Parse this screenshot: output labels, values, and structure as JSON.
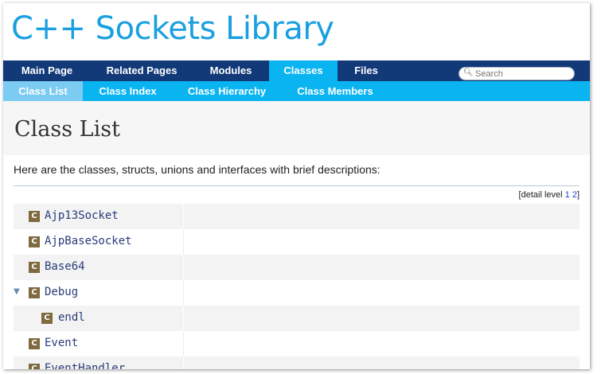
{
  "header": {
    "title": "C++ Sockets Library"
  },
  "nav_main": {
    "tabs": [
      {
        "label": "Main Page"
      },
      {
        "label": "Related Pages"
      },
      {
        "label": "Modules"
      },
      {
        "label": "Classes"
      },
      {
        "label": "Files"
      }
    ],
    "active": "Classes"
  },
  "search": {
    "placeholder": "Search",
    "icon": "search-icon"
  },
  "nav_sub": {
    "tabs": [
      {
        "label": "Class List"
      },
      {
        "label": "Class Index"
      },
      {
        "label": "Class Hierarchy"
      },
      {
        "label": "Class Members"
      }
    ],
    "active": "Class List"
  },
  "page": {
    "title": "Class List",
    "intro": "Here are the classes, structs, unions and interfaces with brief descriptions:",
    "detail_prefix": "[detail level ",
    "detail_levels": [
      "1",
      "2"
    ],
    "detail_suffix": "]"
  },
  "class_badge": "C",
  "classes": [
    {
      "name": "Ajp13Socket",
      "description": ""
    },
    {
      "name": "AjpBaseSocket",
      "description": ""
    },
    {
      "name": "Base64",
      "description": ""
    },
    {
      "name": "Debug",
      "description": "",
      "expanded": true,
      "arrow": "▼"
    },
    {
      "name": "endl",
      "description": "",
      "nested": true
    },
    {
      "name": "Event",
      "description": ""
    },
    {
      "name": "EventHandler",
      "description": ""
    }
  ],
  "colors": {
    "title": "#1aa0e0",
    "nav_main_bg": "#123a78",
    "nav_active": "#0ab4f0",
    "nav_sub_bg": "#0ab4f0",
    "nav_sub_active": "#7ccbf2",
    "badge": "#7f6a3f",
    "class_link": "#283c78"
  }
}
